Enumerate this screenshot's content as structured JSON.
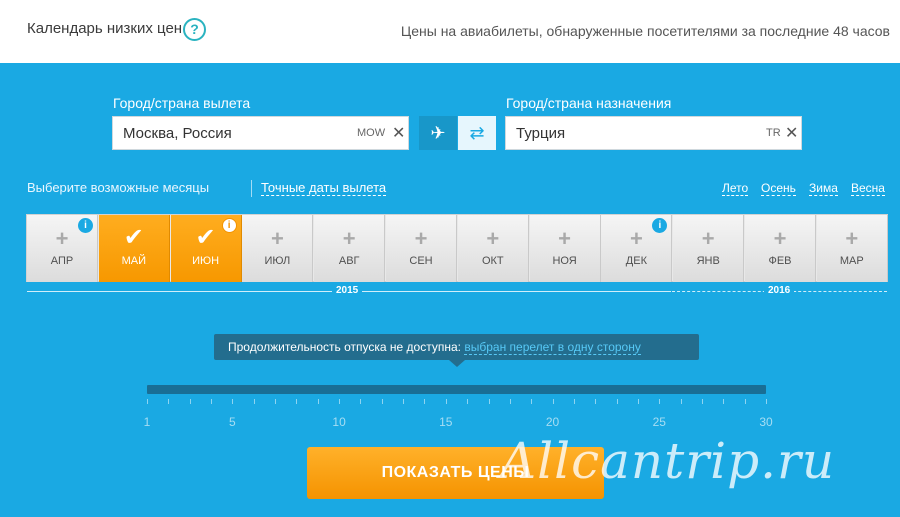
{
  "header": {
    "title": "Календарь низких цен",
    "help_icon": "?",
    "note": "Цены на авиабилеты, обнаруженные посетителями за последние 48 часов"
  },
  "origin": {
    "label": "Город/страна вылета",
    "value": "Москва, Россия",
    "code": "MOW",
    "clear": "✕"
  },
  "destination": {
    "label": "Город/страна назначения",
    "value": "Турция",
    "code": "TR",
    "clear": "✕"
  },
  "trip_toggle": {
    "oneway_icon": "✈",
    "round_icon": "⇄"
  },
  "months_bar": {
    "choose_label": "Выберите возможные месяцы",
    "exact_dates_link": "Точные даты вылета",
    "seasons": [
      "Лето",
      "Осень",
      "Зима",
      "Весна"
    ],
    "months": [
      {
        "name": "АПР",
        "selected": false,
        "info": true
      },
      {
        "name": "МАЙ",
        "selected": true,
        "info": false
      },
      {
        "name": "ИЮН",
        "selected": true,
        "info": true
      },
      {
        "name": "ИЮЛ",
        "selected": false,
        "info": false
      },
      {
        "name": "АВГ",
        "selected": false,
        "info": false
      },
      {
        "name": "СЕН",
        "selected": false,
        "info": false
      },
      {
        "name": "ОКТ",
        "selected": false,
        "info": false
      },
      {
        "name": "НОЯ",
        "selected": false,
        "info": false
      },
      {
        "name": "ДЕК",
        "selected": false,
        "info": true
      },
      {
        "name": "ЯНВ",
        "selected": false,
        "info": false
      },
      {
        "name": "ФЕВ",
        "selected": false,
        "info": false
      },
      {
        "name": "МАР",
        "selected": false,
        "info": false
      }
    ],
    "years": [
      "2015",
      "2016"
    ]
  },
  "duration": {
    "tooltip_text": "Продолжительность отпуска не доступна:",
    "tooltip_link": "выбран перелет в одну сторону",
    "scale_labels": [
      "1",
      "5",
      "10",
      "15",
      "20",
      "25",
      "30"
    ]
  },
  "show_button": "ПОКАЗАТЬ ЦЕНЫ",
  "watermark": "Allcantrip.ru",
  "colors": {
    "background": "#1aa9e3",
    "accent_orange": "#f79800",
    "tooltip_bg": "#236d8e"
  }
}
